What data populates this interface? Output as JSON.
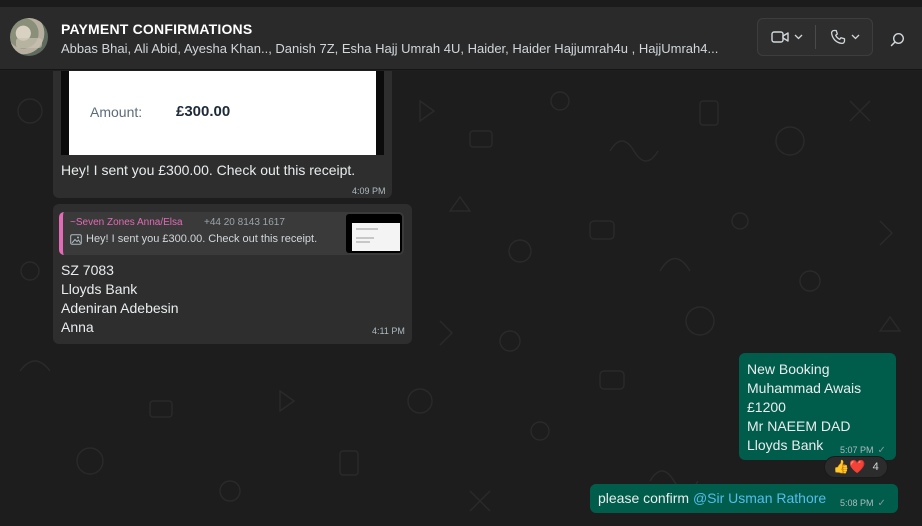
{
  "header": {
    "title": "PAYMENT CONFIRMATIONS",
    "participants": "Abbas Bhai, Ali Abid, Ayesha Khan.., Danish 7Z, Esha Hajj Umrah 4U, Haider, Haider Hajjumrah4u , HajjUmrah4..."
  },
  "messages": [
    {
      "receipt_label": "Amount:",
      "receipt_value": "£300.00",
      "text": "Hey! I sent you £300.00. Check out this receipt.",
      "time": "4:09 PM"
    },
    {
      "quote": {
        "author": "~Seven Zones Anna/Elsa",
        "phone": "+44 20 8143 1617",
        "text": "Hey! I sent you £300.00. Check out this receipt."
      },
      "lines": [
        "SZ 7083",
        "Lloyds Bank",
        "Adeniran Adebesin",
        "Anna"
      ],
      "time": "4:11 PM"
    },
    {
      "lines": [
        "New Booking",
        "Muhammad Awais",
        "£1200",
        "Mr NAEEM DAD",
        "Lloyds Bank"
      ],
      "time": "5:07 PM",
      "reactions": {
        "emojis": "👍❤️",
        "count": "4"
      }
    },
    {
      "text": "please confirm ",
      "mention": "@Sir Usman Rathore",
      "time": "5:08 PM"
    }
  ],
  "icons": [
    "video-call-icon",
    "chevron-down-icon",
    "voice-call-icon",
    "search-icon",
    "photo-icon",
    "read-tick-icon"
  ],
  "colors": {
    "incoming_bubble": "#2e2e2e",
    "outgoing_bubble": "#005c4b",
    "mention": "#53bdeb",
    "quote_author": "#e26ab6"
  }
}
